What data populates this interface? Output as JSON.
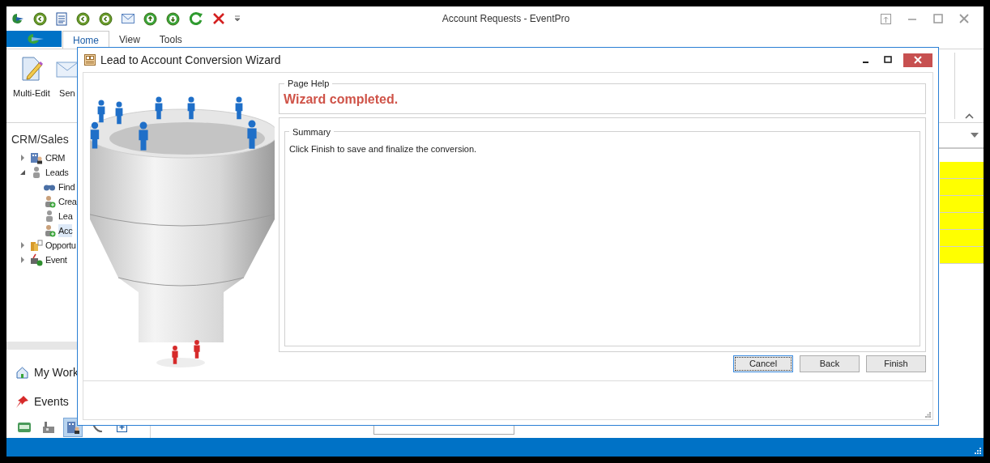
{
  "window": {
    "title": "Account Requests - EventPro"
  },
  "ribbon": {
    "tabs": [
      {
        "label": "Home",
        "selected": true
      },
      {
        "label": "View",
        "selected": false
      },
      {
        "label": "Tools",
        "selected": false
      }
    ],
    "buttons": [
      {
        "label": "Multi-Edit",
        "kind": "edit"
      },
      {
        "label": "Sen",
        "kind": "mail"
      }
    ]
  },
  "navigation": {
    "title": "CRM/Sales",
    "tree": [
      {
        "label": "CRM",
        "kind": "building",
        "expanded": false,
        "selected": false
      },
      {
        "label": "Leads",
        "kind": "person",
        "expanded": true,
        "selected": false,
        "children": [
          {
            "label": "Find",
            "kind": "binoculars",
            "selected": false
          },
          {
            "label": "Crea",
            "kind": "person-add",
            "selected": false
          },
          {
            "label": "Lea",
            "kind": "person",
            "selected": false
          },
          {
            "label": "Acc",
            "kind": "person-add",
            "selected": true
          }
        ]
      },
      {
        "label": "Opportu",
        "kind": "coins",
        "expanded": false,
        "selected": false
      },
      {
        "label": "Event",
        "kind": "event",
        "expanded": false,
        "selected": false
      }
    ],
    "sections": [
      {
        "label": "My Work",
        "kind": "home"
      },
      {
        "label": "Events",
        "kind": "pin"
      }
    ],
    "module_buttons": [
      {
        "kind": "bed",
        "selected": false
      },
      {
        "kind": "factory",
        "selected": false
      },
      {
        "kind": "building",
        "selected": true
      },
      {
        "kind": "phone",
        "selected": false
      },
      {
        "kind": "add",
        "selected": false
      }
    ]
  },
  "dialog": {
    "title": "Lead to Account Conversion Wizard",
    "page_help": {
      "label": "Page Help",
      "message": "Wizard completed."
    },
    "summary": {
      "label": "Summary",
      "text": "Click Finish to save and finalize the conversion."
    },
    "buttons": [
      {
        "label": "Cancel",
        "focused": true
      },
      {
        "label": "Back",
        "focused": false
      },
      {
        "label": "Finish",
        "focused": false
      }
    ]
  }
}
